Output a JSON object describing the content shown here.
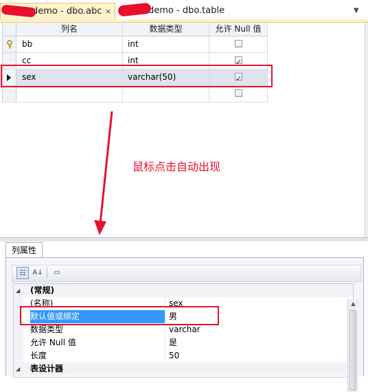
{
  "tabs": [
    {
      "label": "demo - dbo.abc",
      "active": true
    },
    {
      "label": "demo - dbo.table",
      "active": false
    }
  ],
  "tab_close_glyph": "×",
  "grid": {
    "headers": {
      "name": "列名",
      "type": "数据类型",
      "allow_null": "允许 Null 值"
    },
    "rows": [
      {
        "name": "bb",
        "type": "int",
        "allow_null": false,
        "indicator": "key-icon"
      },
      {
        "name": "cc",
        "type": "int",
        "allow_null": true,
        "indicator": ""
      },
      {
        "name": "sex",
        "type": "varchar(50)",
        "allow_null": true,
        "indicator": "current-row-arrow-icon"
      },
      {
        "name": "",
        "type": "",
        "allow_null": false,
        "indicator": ""
      }
    ]
  },
  "annotation": "鼠标点击自动出现",
  "properties": {
    "tab_label": "列属性",
    "categories": [
      {
        "label": "(常规)",
        "items": [
          {
            "name": "(名称)",
            "value": "sex"
          },
          {
            "name": "默认值或绑定",
            "value": "男",
            "selected": true
          },
          {
            "name": "数据类型",
            "value": "varchar"
          },
          {
            "name": "允许 Null 值",
            "value": "是"
          },
          {
            "name": "长度",
            "value": "50"
          }
        ]
      },
      {
        "label": "表设计器",
        "items": []
      }
    ]
  },
  "colors": {
    "accent": "#e8102e",
    "selection": "#3399ff"
  }
}
